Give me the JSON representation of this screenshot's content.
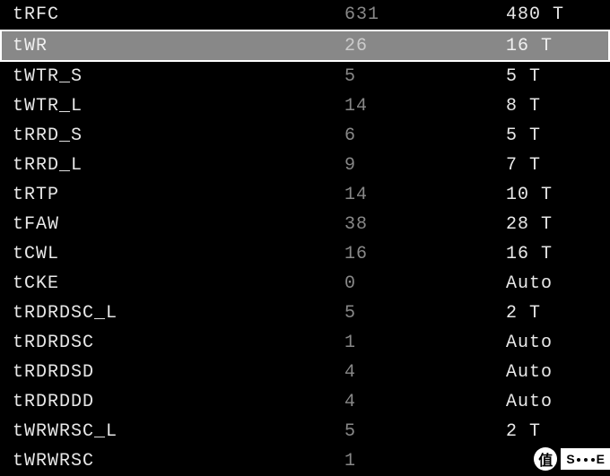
{
  "rows": [
    {
      "name": "tRFC",
      "current": "631",
      "target": "480 T",
      "selected": false
    },
    {
      "name": "tWR",
      "current": "26",
      "target": "16 T",
      "selected": true
    },
    {
      "name": "tWTR_S",
      "current": "5",
      "target": "5 T",
      "selected": false
    },
    {
      "name": "tWTR_L",
      "current": "14",
      "target": "8 T",
      "selected": false
    },
    {
      "name": "tRRD_S",
      "current": "6",
      "target": "5 T",
      "selected": false
    },
    {
      "name": "tRRD_L",
      "current": "9",
      "target": "7 T",
      "selected": false
    },
    {
      "name": "tRTP",
      "current": "14",
      "target": "10 T",
      "selected": false
    },
    {
      "name": "tFAW",
      "current": "38",
      "target": "28 T",
      "selected": false
    },
    {
      "name": "tCWL",
      "current": "16",
      "target": "16 T",
      "selected": false
    },
    {
      "name": "tCKE",
      "current": "0",
      "target": "Auto",
      "selected": false
    },
    {
      "name": "tRDRDSC_L",
      "current": "5",
      "target": "2 T",
      "selected": false
    },
    {
      "name": "tRDRDSC",
      "current": "1",
      "target": "Auto",
      "selected": false
    },
    {
      "name": "tRDRDSD",
      "current": "4",
      "target": "Auto",
      "selected": false
    },
    {
      "name": "tRDRDDD",
      "current": "4",
      "target": "Auto",
      "selected": false
    },
    {
      "name": "tWRWRSC_L",
      "current": "5",
      "target": "2 T",
      "selected": false
    },
    {
      "name": "tWRWRSC",
      "current": "1",
      "target": "",
      "selected": false
    }
  ],
  "watermark": {
    "circle": "值",
    "text_left": "S",
    "text_right": "E"
  }
}
